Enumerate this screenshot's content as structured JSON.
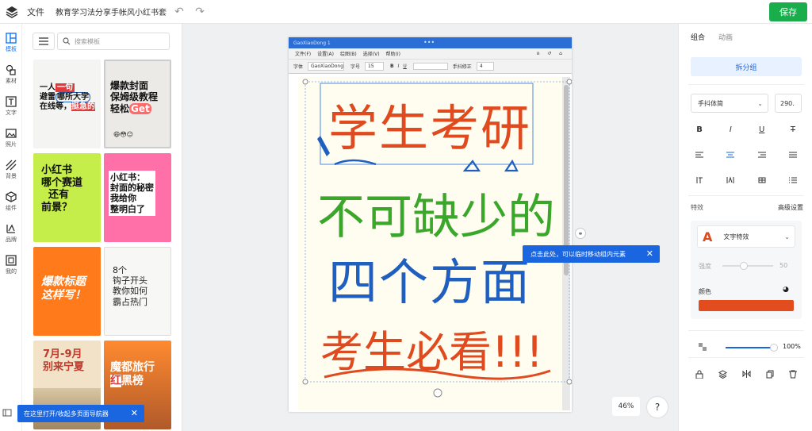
{
  "topbar": {
    "file_label": "文件",
    "doc_title": "教育学习法分享手帐风小红书套...",
    "save_label": "保存"
  },
  "rail": {
    "items": [
      {
        "label": "模板",
        "icon": "template-icon"
      },
      {
        "label": "素材",
        "icon": "material-icon"
      },
      {
        "label": "文字",
        "icon": "text-icon"
      },
      {
        "label": "照片",
        "icon": "photo-icon"
      },
      {
        "label": "背景",
        "icon": "background-icon"
      },
      {
        "label": "组件",
        "icon": "component-icon"
      },
      {
        "label": "品牌",
        "icon": "brand-icon"
      },
      {
        "label": "我的",
        "icon": "my-icon"
      }
    ]
  },
  "templates": {
    "search_placeholder": "搜索模板",
    "items": [
      {
        "text": "一人一句\n避雷哪所大学\n在线等，挺急的",
        "bg": "#f4f4f2",
        "fg": "#111"
      },
      {
        "text": "爆款封面\n保姆级教程\n轻松Get",
        "bg": "#eceae6",
        "fg": "#111"
      },
      {
        "text": "小红书\n哪个赛道\n还有\n前景？",
        "bg": "#c6ee4a",
        "fg": "#111"
      },
      {
        "text": "小红书：\n封面的秘密\n我给你\n整明白了",
        "bg": "#ff6fa8",
        "fg": "#111"
      },
      {
        "text": "爆款标题\n这样写！",
        "bg": "#ff7a1a",
        "fg": "#fff"
      },
      {
        "text": "8个\n钩子开头\n教你如何\n霸占热门",
        "bg": "#f7f7f5",
        "fg": "#222"
      },
      {
        "text": "7月-9月\n别来宁夏",
        "bg": "#f1e2c8",
        "fg": "#c0392b"
      },
      {
        "text": "魔都旅行\n红黑榜",
        "bg": "#ff8a30",
        "fg": "#fff"
      }
    ]
  },
  "artboard": {
    "window_title": "GaoXiaoDong 1",
    "menu": [
      "文件(F)",
      "设置(A)",
      "绘图(B)",
      "选择(V)",
      "帮助(I)"
    ],
    "toolbar": {
      "font_label": "字体",
      "font_value": "GaoXiaoDong",
      "size_label": "字号",
      "size_value": "15",
      "bold": "B",
      "italic": "I",
      "underline": "U",
      "stroke_label": "手抖修正",
      "stroke_value": "4"
    },
    "lines": [
      {
        "text": "学生考研",
        "color": "#e04a1f"
      },
      {
        "text": "不可缺少的",
        "color": "#3aa62a"
      },
      {
        "text": "四个方面",
        "color": "#1f5fbf"
      },
      {
        "text": "考生必看!!!",
        "color": "#e04a1f"
      }
    ]
  },
  "tooltip": {
    "text": "点击此处，可以临时移动组内元素",
    "close": "✕"
  },
  "bottom_hint": {
    "text": "在这里打开/收起多页面导航器",
    "close": "✕"
  },
  "zoom": {
    "value": "46%"
  },
  "help": {
    "label": "?"
  },
  "right": {
    "tabs": [
      "组合",
      "动画"
    ],
    "ungroup_label": "拆分组",
    "font_family": "手抖体简",
    "font_size": "290.",
    "style_buttons": [
      "B",
      "I",
      "U",
      "T"
    ],
    "effects_label": "特效",
    "advanced_label": "高级设置",
    "effect_name": "文字特效",
    "strength_label": "强度",
    "strength_value": "50",
    "color_label": "颜色",
    "opacity_value": "100%",
    "accent": "#e34d1d"
  }
}
